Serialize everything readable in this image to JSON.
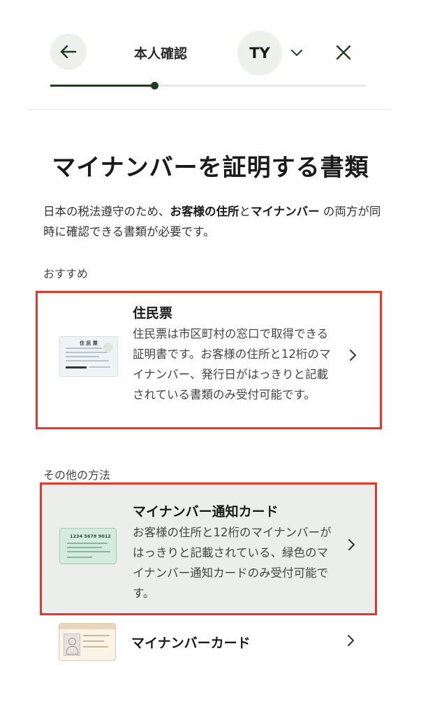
{
  "header": {
    "title": "本人確認",
    "avatar_initials": "TY",
    "progress_percent": 33
  },
  "page_title": "マイナンバーを証明する書類",
  "description": {
    "part1": "日本の税法遵守のため、",
    "bold1": "お客様の住所",
    "part2": "と",
    "bold2": "マイナンバー",
    "part3": " の両方が同時に確認できる書類が必要です。"
  },
  "sections": {
    "recommended_label": "おすすめ",
    "other_label": "その他の方法"
  },
  "options": [
    {
      "title": "住民票",
      "description": "住民票は市区町村の窓口で取得できる証明書です。お客様の住所と12桁のマイナンバー、発行日がはっきりと記載されている書類のみ受付可能です。",
      "thumb_label": "住 民 票"
    },
    {
      "title": "マイナンバー通知カード",
      "description": "お客様の住所と12桁のマイナンバーがはっきりと記載されている、緑色のマイナンバー通知カードのみ受付可能です。",
      "thumb_number": "1234 5678 9012"
    },
    {
      "title": "マイナンバーカード",
      "description": ""
    }
  ],
  "colors": {
    "accent": "#1f3d21",
    "highlight_border": "#e5362a",
    "selected_bg": "#eceeec"
  }
}
